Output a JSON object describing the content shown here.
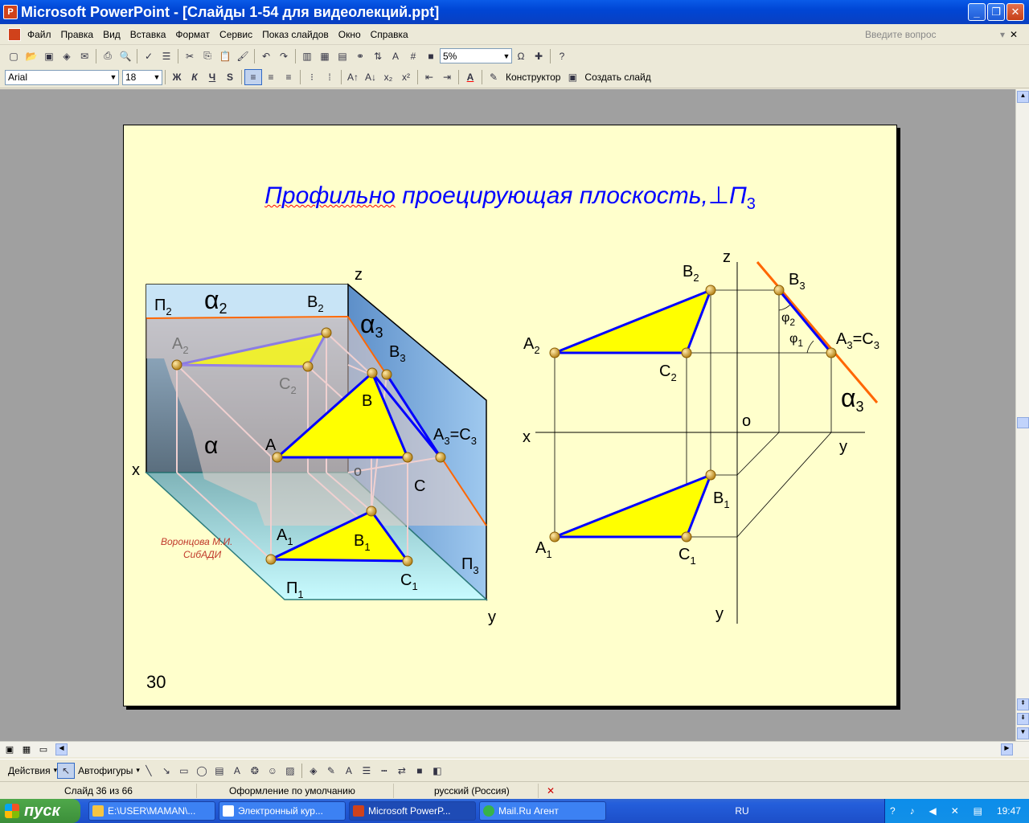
{
  "window": {
    "title": "Microsoft PowerPoint - [Слайды 1-54 для видеолекций.ppt]",
    "app_icon": "powerpoint-icon",
    "minimize": "_",
    "restore": "❐",
    "close": "✕"
  },
  "menu": {
    "items": [
      "Файл",
      "Правка",
      "Вид",
      "Вставка",
      "Формат",
      "Сервис",
      "Показ слайдов",
      "Окно",
      "Справка"
    ],
    "ask_placeholder": "Введите вопрос",
    "close_doc": "✕"
  },
  "standard_toolbar": {
    "zoom": "5%"
  },
  "format_toolbar": {
    "font": "Arial",
    "size": "18",
    "bold": "Ж",
    "italic": "К",
    "underline": "Ч",
    "shadow": "S",
    "designer": "Конструктор",
    "new_slide": "Создать слайд"
  },
  "slide": {
    "title_part1": "Профильно",
    "title_part2": " проецирующая плоскость,⊥П",
    "title_sub": "3",
    "number": "30",
    "author_line1": "Воронцова М.И.",
    "author_line2": "СибАДИ",
    "labels": {
      "z": "z",
      "x": "x",
      "y": "y",
      "o": "o",
      "P": "П",
      "alpha": "α",
      "A": "A",
      "B": "B",
      "C": "C",
      "sub1": "1",
      "sub2": "2",
      "sub3": "3",
      "A3C3": "=C",
      "phi": "φ"
    },
    "colors": {
      "background": "#ffffcc",
      "triangle_fill": "#ffff00",
      "triangle_edge": "#0000ff",
      "trace": "#ff6600",
      "title": "#0000ff"
    }
  },
  "draw_toolbar": {
    "actions": "Действия",
    "autoshapes": "Автофигуры"
  },
  "status": {
    "slide": "Слайд 36 из 66",
    "design": "Оформление по умолчанию",
    "language": "русский (Россия)"
  },
  "taskbar": {
    "start": "пуск",
    "tasks": [
      {
        "label": "E:\\USER\\MAMAN\\...",
        "color": "#f5c542"
      },
      {
        "label": "Электронный кур...",
        "color": "#ffffff"
      },
      {
        "label": "Microsoft PowerP...",
        "color": "#d0421b"
      },
      {
        "label": "Mail.Ru Агент",
        "color": "#37b34a"
      }
    ],
    "lang": "RU",
    "time": "19:47"
  }
}
